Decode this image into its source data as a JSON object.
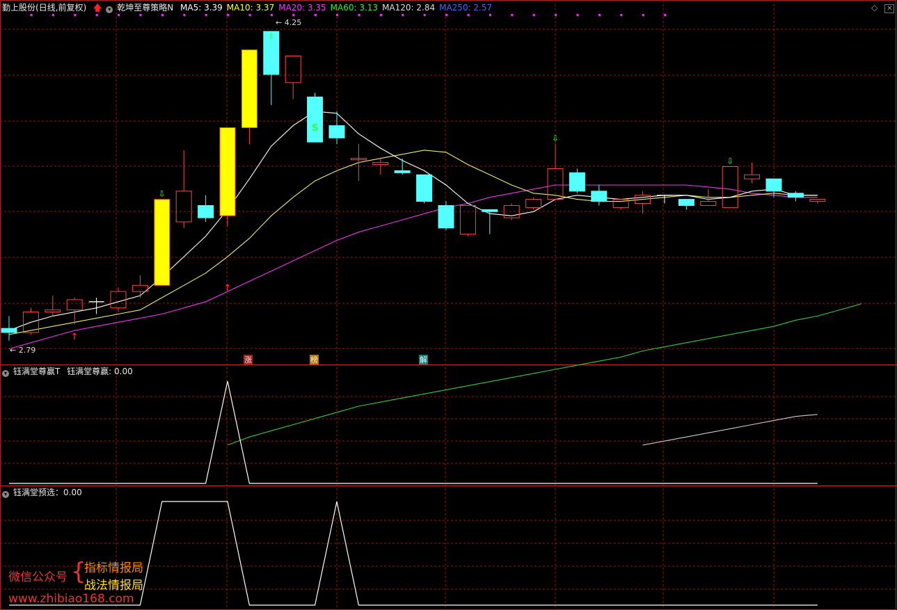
{
  "main_header": {
    "stock_name": "勤上股份",
    "period": "(日线,前复权)",
    "strategy": "乾坤至尊策略N",
    "ma": [
      {
        "label": "MA5: 3.39",
        "color": "#ffffff"
      },
      {
        "label": "MA10: 3.37",
        "color": "#ffff33"
      },
      {
        "label": "MA20: 3.35",
        "color": "#ff33ff"
      },
      {
        "label": "MA60: 3.13",
        "color": "#33ee33"
      },
      {
        "label": "MA120: 2.84",
        "color": "#dddddd"
      },
      {
        "label": "MA250: 2.57",
        "color": "#4466ff"
      }
    ]
  },
  "panel2_header": {
    "name": "钰满堂尊赢T",
    "value_label": "钰满堂尊赢: 0.00"
  },
  "panel3_header": {
    "name": "钰满堂预选：0.00"
  },
  "price_labels": {
    "high": "4.25",
    "low": "2.79"
  },
  "signal_tags": [
    {
      "text": "涨",
      "bg": "#992222",
      "fg": "#ffdddd"
    },
    {
      "text": "榜",
      "bg": "#aa7711",
      "fg": "#ffeecc"
    },
    {
      "text": "解",
      "bg": "#227777",
      "fg": "#ddffff"
    }
  ],
  "s_marker": "S",
  "watermark": {
    "line1": "微信公众号",
    "brace": "{",
    "item1": "指标情报局",
    "item2": "战法情报局",
    "url": "www.zhibiao168.com"
  },
  "colors": {
    "up": "#ff4444",
    "down": "#55ffff",
    "limit_up": "#ffff00",
    "grid": "#8b1a1a"
  },
  "candles": [
    {
      "o": 2.85,
      "h": 2.91,
      "l": 2.79,
      "c": 2.83,
      "col": "down"
    },
    {
      "o": 2.83,
      "h": 2.95,
      "l": 2.82,
      "c": 2.93,
      "col": "up"
    },
    {
      "o": 2.93,
      "h": 3.01,
      "l": 2.91,
      "c": 2.94,
      "col": "up"
    },
    {
      "o": 2.94,
      "h": 3.0,
      "l": 2.87,
      "c": 2.99,
      "col": "up"
    },
    {
      "o": 2.98,
      "h": 3.0,
      "l": 2.92,
      "c": 2.98,
      "col": "doji"
    },
    {
      "o": 2.95,
      "h": 3.05,
      "l": 2.93,
      "c": 3.03,
      "col": "up"
    },
    {
      "o": 3.03,
      "h": 3.11,
      "l": 3.0,
      "c": 3.06,
      "col": "up"
    },
    {
      "o": 3.06,
      "h": 3.48,
      "l": 3.06,
      "c": 3.48,
      "col": "limit"
    },
    {
      "o": 3.37,
      "h": 3.72,
      "l": 3.34,
      "c": 3.52,
      "col": "up"
    },
    {
      "o": 3.39,
      "h": 3.5,
      "l": 3.37,
      "c": 3.45,
      "col": "down"
    },
    {
      "o": 3.4,
      "h": 3.83,
      "l": 3.35,
      "c": 3.83,
      "col": "limit"
    },
    {
      "o": 3.83,
      "h": 4.21,
      "l": 3.75,
      "c": 4.21,
      "col": "limit"
    },
    {
      "o": 4.09,
      "h": 4.25,
      "l": 3.94,
      "c": 4.3,
      "col": "down"
    },
    {
      "o": 4.05,
      "h": 4.15,
      "l": 3.97,
      "c": 4.18,
      "col": "up"
    },
    {
      "o": 3.98,
      "h": 4.0,
      "l": 3.76,
      "c": 3.76,
      "col": "down"
    },
    {
      "o": 3.84,
      "h": 3.91,
      "l": 3.75,
      "c": 3.78,
      "col": "down"
    },
    {
      "o": 3.68,
      "h": 3.75,
      "l": 3.57,
      "c": 3.68,
      "col": "up"
    },
    {
      "o": 3.65,
      "h": 3.68,
      "l": 3.6,
      "c": 3.66,
      "col": "up"
    },
    {
      "o": 3.62,
      "h": 3.68,
      "l": 3.6,
      "c": 3.61,
      "col": "down"
    },
    {
      "o": 3.6,
      "h": 3.6,
      "l": 3.46,
      "c": 3.47,
      "col": "down"
    },
    {
      "o": 3.45,
      "h": 3.47,
      "l": 3.33,
      "c": 3.34,
      "col": "down"
    },
    {
      "o": 3.31,
      "h": 3.45,
      "l": 3.3,
      "c": 3.45,
      "col": "up"
    },
    {
      "o": 3.43,
      "h": 3.43,
      "l": 3.31,
      "c": 3.42,
      "col": "down"
    },
    {
      "o": 3.39,
      "h": 3.46,
      "l": 3.38,
      "c": 3.45,
      "col": "up"
    },
    {
      "o": 3.44,
      "h": 3.49,
      "l": 3.43,
      "c": 3.48,
      "col": "up"
    },
    {
      "o": 3.48,
      "h": 3.75,
      "l": 3.48,
      "c": 3.63,
      "col": "up"
    },
    {
      "o": 3.61,
      "h": 3.63,
      "l": 3.51,
      "c": 3.52,
      "col": "down"
    },
    {
      "o": 3.52,
      "h": 3.55,
      "l": 3.45,
      "c": 3.47,
      "col": "down"
    },
    {
      "o": 3.44,
      "h": 3.48,
      "l": 3.43,
      "c": 3.48,
      "col": "up"
    },
    {
      "o": 3.46,
      "h": 3.52,
      "l": 3.41,
      "c": 3.5,
      "col": "up"
    },
    {
      "o": 3.5,
      "h": 3.5,
      "l": 3.46,
      "c": 3.5,
      "col": "doji"
    },
    {
      "o": 3.48,
      "h": 3.48,
      "l": 3.43,
      "c": 3.45,
      "col": "down"
    },
    {
      "o": 3.45,
      "h": 3.53,
      "l": 3.45,
      "c": 3.47,
      "col": "up"
    },
    {
      "o": 3.44,
      "h": 3.64,
      "l": 3.44,
      "c": 3.64,
      "col": "up"
    },
    {
      "o": 3.58,
      "h": 3.66,
      "l": 3.56,
      "c": 3.6,
      "col": "up"
    },
    {
      "o": 3.58,
      "h": 3.58,
      "l": 3.49,
      "c": 3.52,
      "col": "down"
    },
    {
      "o": 3.51,
      "h": 3.52,
      "l": 3.47,
      "c": 3.49,
      "col": "down"
    },
    {
      "o": 3.47,
      "h": 3.48,
      "l": 3.46,
      "c": 3.48,
      "col": "up"
    }
  ],
  "ma5": [
    2.84,
    2.88,
    2.91,
    2.93,
    2.95,
    2.98,
    3.01,
    3.1,
    3.2,
    3.3,
    3.43,
    3.58,
    3.74,
    3.84,
    3.91,
    3.9,
    3.8,
    3.73,
    3.67,
    3.62,
    3.55,
    3.46,
    3.41,
    3.4,
    3.42,
    3.48,
    3.5,
    3.49,
    3.48,
    3.49,
    3.5,
    3.5,
    3.48,
    3.49,
    3.52,
    3.53,
    3.5,
    3.5
  ],
  "ma10": [
    2.82,
    2.84,
    2.86,
    2.88,
    2.9,
    2.92,
    2.94,
    3.0,
    3.06,
    3.12,
    3.2,
    3.29,
    3.4,
    3.49,
    3.57,
    3.62,
    3.66,
    3.68,
    3.7,
    3.72,
    3.71,
    3.65,
    3.6,
    3.55,
    3.51,
    3.5,
    3.48,
    3.47,
    3.47,
    3.48,
    3.49,
    3.5,
    3.49,
    3.49,
    3.5,
    3.51,
    3.5,
    3.5
  ],
  "ma20": [
    2.75,
    2.78,
    2.81,
    2.84,
    2.86,
    2.88,
    2.9,
    2.92,
    2.95,
    2.98,
    3.03,
    3.08,
    3.13,
    3.18,
    3.23,
    3.28,
    3.32,
    3.35,
    3.38,
    3.41,
    3.44,
    3.46,
    3.49,
    3.51,
    3.53,
    3.55,
    3.55,
    3.55,
    3.55,
    3.55,
    3.55,
    3.55,
    3.54,
    3.53,
    3.51,
    3.5,
    3.49,
    3.49
  ],
  "ma60": {
    "start_index": 10,
    "values": [
      2.28,
      2.32,
      2.35,
      2.38,
      2.41,
      2.44,
      2.47,
      2.49,
      2.51,
      2.53,
      2.55,
      2.57,
      2.59,
      2.61,
      2.63,
      2.65,
      2.67,
      2.69,
      2.71,
      2.74,
      2.76,
      2.78,
      2.8,
      2.82,
      2.84,
      2.86,
      2.89,
      2.91,
      2.94,
      2.97
    ]
  },
  "ma120": {
    "start_index": 29,
    "values": [
      2.28,
      2.3,
      2.32,
      2.34,
      2.36,
      2.38,
      2.4,
      2.42,
      2.43
    ]
  },
  "indicator_T": [
    0,
    0,
    0,
    0,
    0,
    0,
    0,
    0,
    0,
    0,
    1,
    0,
    0,
    0,
    0,
    0,
    0,
    0,
    0,
    0,
    0,
    0,
    0,
    0,
    0,
    0,
    0,
    0,
    0,
    0,
    0,
    0,
    0,
    0,
    0,
    0,
    0,
    0
  ],
  "indicator_pre": [
    0,
    0,
    0,
    0,
    0,
    0,
    0,
    1,
    1,
    1,
    1,
    0,
    0,
    0,
    0,
    1,
    0,
    0,
    0,
    0,
    0,
    0,
    0,
    0,
    0,
    0,
    0,
    0,
    0,
    0,
    0,
    0,
    0,
    0,
    0,
    0,
    0,
    0
  ]
}
